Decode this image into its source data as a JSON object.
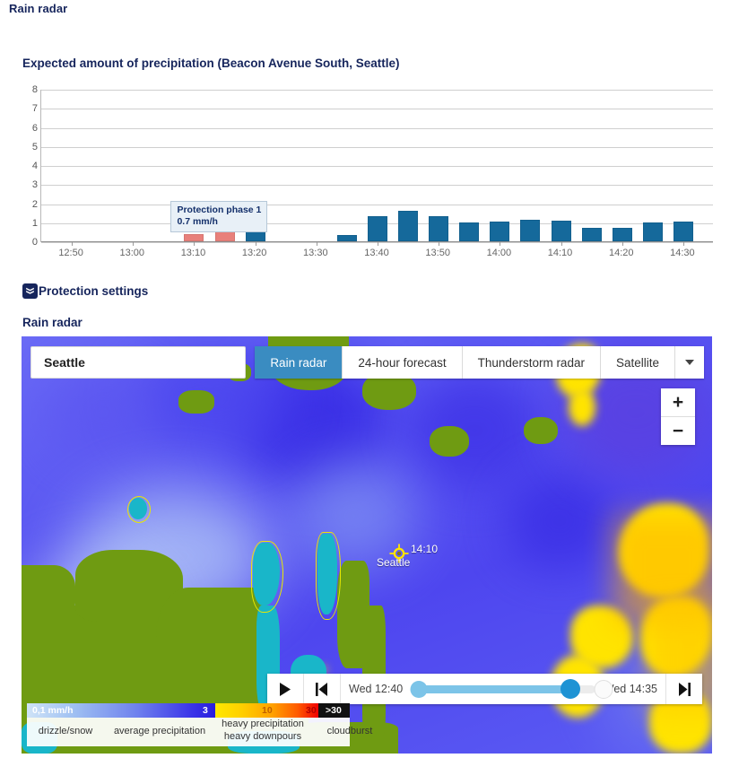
{
  "page": {
    "title": "Rain radar"
  },
  "chart_section": {
    "title": "Expected amount of precipitation (Beacon Avenue South, Seattle)",
    "tooltip": {
      "line1": "Protection phase 1",
      "line2": "0.7 mm/h"
    }
  },
  "chart_data": {
    "type": "bar",
    "title": "Expected amount of precipitation (Beacon Avenue South, Seattle)",
    "xlabel": "",
    "ylabel": "",
    "ylim": [
      0,
      8
    ],
    "yticks": [
      "0",
      "1",
      "2",
      "3",
      "4",
      "5",
      "6",
      "7",
      "8"
    ],
    "xticks": [
      "12:50",
      "13:00",
      "13:10",
      "13:20",
      "13:30",
      "13:40",
      "13:50",
      "14:00",
      "14:10",
      "14:20",
      "14:30"
    ],
    "grid": true,
    "legend": "none",
    "colors": {
      "blue": "#15699b",
      "salmon": "#e8807b"
    },
    "categories": [
      "13:10",
      "13:15",
      "13:20",
      "13:35",
      "13:40",
      "13:45",
      "13:50",
      "13:55",
      "14:00",
      "14:05",
      "14:10",
      "14:15",
      "14:20",
      "14:25",
      "14:30"
    ],
    "values": [
      0.4,
      0.7,
      0.7,
      0.35,
      1.3,
      1.6,
      1.3,
      1.0,
      1.05,
      1.15,
      1.1,
      0.7,
      0.7,
      1.0,
      1.05
    ],
    "series": [
      {
        "name": "Protection phase",
        "values": [
          0.4,
          0.7,
          null,
          null,
          null,
          null,
          null,
          null,
          null,
          null,
          null,
          null,
          null,
          null,
          null
        ],
        "color": "#e8807b"
      },
      {
        "name": "Precipitation",
        "values": [
          null,
          null,
          0.7,
          0.35,
          1.3,
          1.6,
          1.3,
          1.0,
          1.05,
          1.15,
          1.1,
          0.7,
          0.7,
          1.0,
          1.05
        ],
        "color": "#15699b"
      }
    ]
  },
  "protection": {
    "label": "Protection settings",
    "icon": "shield-chevron-icon"
  },
  "radar_section": {
    "title": "Rain radar"
  },
  "map": {
    "search_value": "Seattle",
    "tabs": [
      {
        "label": "Rain radar",
        "active": true
      },
      {
        "label": "24-hour forecast",
        "active": false
      },
      {
        "label": "Thunderstorm radar",
        "active": false
      },
      {
        "label": "Satellite",
        "active": false
      }
    ],
    "zoom_in": "+",
    "zoom_out": "−",
    "marker": {
      "time": "14:10",
      "name": "Seattle"
    },
    "player": {
      "play": "▶",
      "skip_back": "⏮",
      "skip_forward": "⏭",
      "start_time": "Wed 12:40",
      "end_time": "Wed 14:35"
    },
    "legend": {
      "unit": "0,1 mm/h",
      "stops": [
        "3",
        "10",
        "30",
        ">30"
      ],
      "labels": [
        "drizzle/snow",
        "average precipitation",
        "heavy precipitation\nheavy downpours",
        "cloudburst"
      ]
    }
  }
}
